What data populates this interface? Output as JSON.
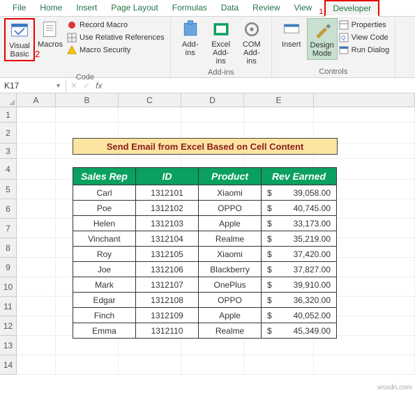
{
  "tabs": {
    "file": "File",
    "home": "Home",
    "insert": "Insert",
    "pagelayout": "Page Layout",
    "formulas": "Formulas",
    "data": "Data",
    "review": "Review",
    "view": "View",
    "developer": "Developer"
  },
  "annotations": {
    "dev": "1",
    "vb": "2"
  },
  "ribbon": {
    "code": {
      "label": "Code",
      "visual_basic": "Visual Basic",
      "macros": "Macros",
      "record": "Record Macro",
      "relative": "Use Relative References",
      "security": "Macro Security"
    },
    "addins": {
      "label": "Add-ins",
      "addins": "Add-ins",
      "excel_addins": "Excel Add-ins",
      "com": "COM Add-ins"
    },
    "controls": {
      "label": "Controls",
      "insert": "Insert",
      "design": "Design Mode",
      "properties": "Properties",
      "viewcode": "View Code",
      "rundialog": "Run Dialog"
    }
  },
  "namebox": {
    "value": "K17",
    "fx": "fx"
  },
  "cols": [
    "A",
    "B",
    "C",
    "D",
    "E"
  ],
  "rows": [
    "1",
    "2",
    "3",
    "4",
    "5",
    "6",
    "7",
    "8",
    "9",
    "10",
    "11",
    "12",
    "13",
    "14"
  ],
  "title": "Send Email from Excel Based on Cell Content",
  "headers": {
    "rep": "Sales Rep",
    "id": "ID",
    "product": "Product",
    "rev": "Rev Earned"
  },
  "data": [
    {
      "rep": "Carl",
      "id": "1312101",
      "product": "Xiaomi",
      "cur": "$",
      "amt": "39,058.00"
    },
    {
      "rep": "Poe",
      "id": "1312102",
      "product": "OPPO",
      "cur": "$",
      "amt": "40,745.00"
    },
    {
      "rep": "Helen",
      "id": "1312103",
      "product": "Apple",
      "cur": "$",
      "amt": "33,173.00"
    },
    {
      "rep": "Vinchant",
      "id": "1312104",
      "product": "Realme",
      "cur": "$",
      "amt": "35,219.00"
    },
    {
      "rep": "Roy",
      "id": "1312105",
      "product": "Xiaomi",
      "cur": "$",
      "amt": "37,420.00"
    },
    {
      "rep": "Joe",
      "id": "1312106",
      "product": "Blackberry",
      "cur": "$",
      "amt": "37,827.00"
    },
    {
      "rep": "Mark",
      "id": "1312107",
      "product": "OnePlus",
      "cur": "$",
      "amt": "39,910.00"
    },
    {
      "rep": "Edgar",
      "id": "1312108",
      "product": "OPPO",
      "cur": "$",
      "amt": "36,320.00"
    },
    {
      "rep": "Finch",
      "id": "1312109",
      "product": "Apple",
      "cur": "$",
      "amt": "40,052.00"
    },
    {
      "rep": "Emma",
      "id": "1312110",
      "product": "Realme",
      "cur": "$",
      "amt": "45,349.00"
    }
  ],
  "watermark": "wsxdn.com"
}
